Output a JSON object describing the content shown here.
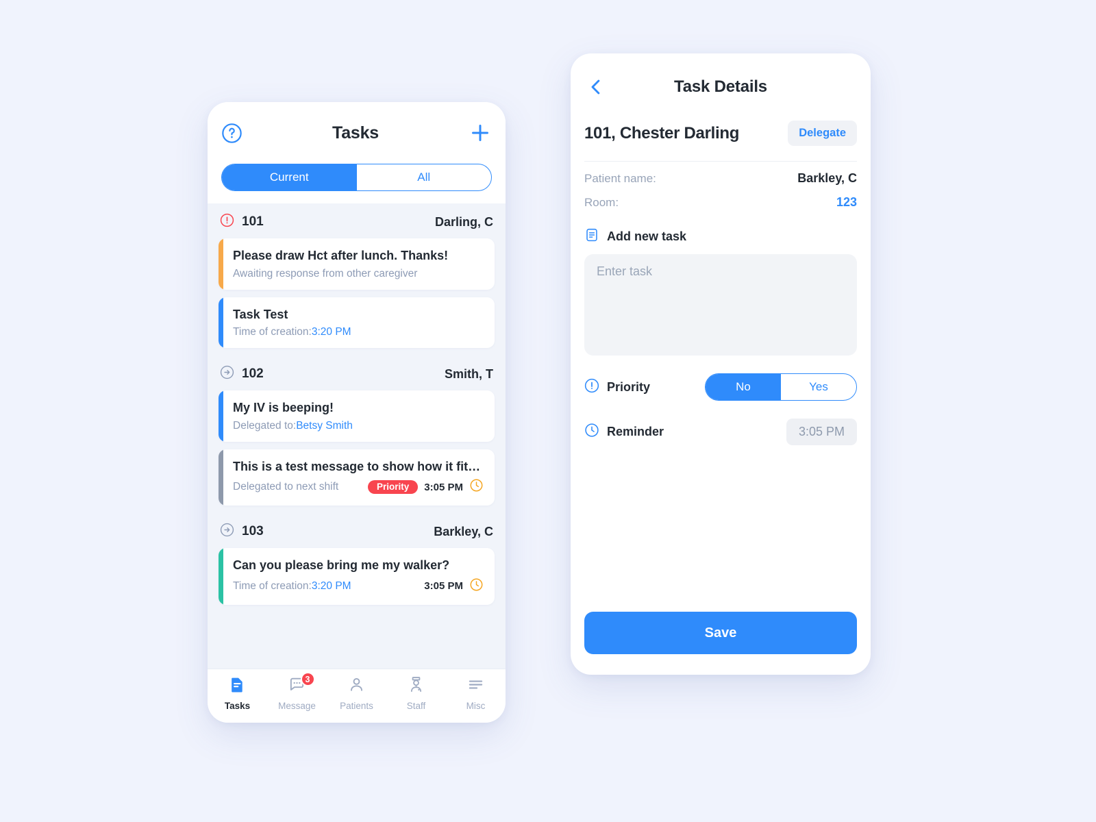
{
  "tasks_screen": {
    "header": {
      "title": "Tasks",
      "help_icon": "help-circle-icon",
      "add_icon": "plus-icon"
    },
    "segmented": {
      "options": [
        "Current",
        "All"
      ],
      "selected": "Current"
    },
    "groups": [
      {
        "status_icon": "alert-circle-icon",
        "status_color": "#f8454f",
        "room": "101",
        "patient": "Darling, C",
        "tasks": [
          {
            "bar_color": "#f7a94a",
            "title": "Please draw Hct after lunch. Thanks!",
            "sub_prefix": "Awaiting response from other caregiver",
            "sub_link": "",
            "priority_label": "",
            "time": ""
          },
          {
            "bar_color": "#2f8bfb",
            "title": "Task Test",
            "sub_prefix": "Time of creation: ",
            "sub_link": "3:20 PM",
            "priority_label": "",
            "time": ""
          }
        ]
      },
      {
        "status_icon": "arrow-circle-right-icon",
        "status_color": "#8d9bb5",
        "room": "102",
        "patient": "Smith, T",
        "tasks": [
          {
            "bar_color": "#2f8bfb",
            "title": "My IV is beeping!",
            "sub_prefix": "Delegated to: ",
            "sub_link": "Betsy Smith",
            "priority_label": "",
            "time": ""
          },
          {
            "bar_color": "#8e99ab",
            "title": "This is a test message to show how it fits whe...",
            "sub_prefix": "Delegated to next shift",
            "sub_link": "",
            "priority_label": "Priority",
            "time": "3:05 PM"
          }
        ]
      },
      {
        "status_icon": "arrow-circle-right-icon",
        "status_color": "#8d9bb5",
        "room": "103",
        "patient": "Barkley, C",
        "tasks": [
          {
            "bar_color": "#2bc2a4",
            "title": "Can you please bring me my walker?",
            "sub_prefix": "Time of creation: ",
            "sub_link": "3:20 PM",
            "priority_label": "",
            "time": "3:05 PM"
          }
        ]
      }
    ],
    "bottom_nav": [
      {
        "label": "Tasks",
        "icon": "document-icon",
        "active": true,
        "badge": ""
      },
      {
        "label": "Message",
        "icon": "chat-bubble-icon",
        "active": false,
        "badge": "3"
      },
      {
        "label": "Patients",
        "icon": "person-icon",
        "active": false,
        "badge": ""
      },
      {
        "label": "Staff",
        "icon": "nurse-icon",
        "active": false,
        "badge": ""
      },
      {
        "label": "Misc",
        "icon": "menu-lines-icon",
        "active": false,
        "badge": ""
      }
    ]
  },
  "detail_screen": {
    "back_icon": "chevron-left-icon",
    "title": "Task Details",
    "patient_heading": "101, Chester Darling",
    "delegate_label": "Delegate",
    "fields": [
      {
        "key": "Patient name:",
        "value": "Barkley, C",
        "value_blue": false
      },
      {
        "key": "Room:",
        "value": "123",
        "value_blue": true
      }
    ],
    "add_task": {
      "icon": "note-lines-icon",
      "label": "Add new task",
      "placeholder": "Enter task",
      "value": ""
    },
    "priority": {
      "icon": "alert-circle-icon",
      "label": "Priority",
      "options": [
        "No",
        "Yes"
      ],
      "selected": "No"
    },
    "reminder": {
      "icon": "clock-icon",
      "label": "Reminder",
      "value": "3:05 PM"
    },
    "save_label": "Save"
  },
  "colors": {
    "page_bg": "#f0f3fd",
    "accent": "#2f8bfb",
    "danger": "#f8454f",
    "warning": "#f7a94a",
    "success": "#2bc2a4",
    "muted": "#8d9bb5"
  }
}
